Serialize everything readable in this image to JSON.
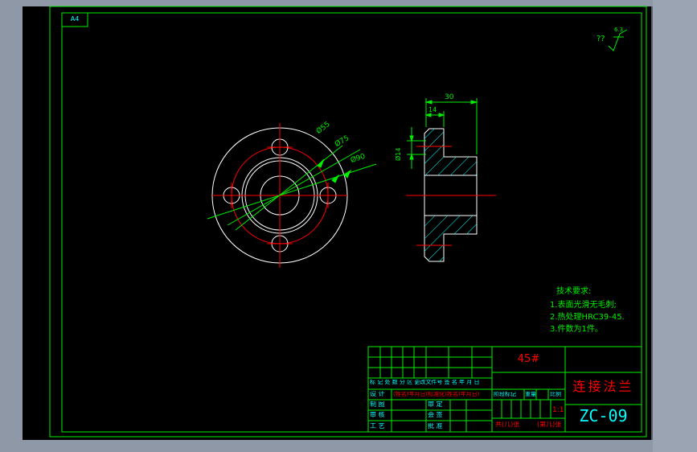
{
  "colors": {
    "background_gray": "#8e98a7",
    "line_green": "#00ee00",
    "line_red": "#ff0000",
    "line_white": "#ffffff",
    "hatch_cyan": "#00ffff",
    "text_cyan": "#00ffff"
  },
  "frame": {
    "sheet_label": "A4"
  },
  "roughness_note": {
    "prefix": "??",
    "value": "6.3"
  },
  "front_view": {
    "dim_labels": [
      "Ø55",
      "Ø75",
      "Ø90"
    ]
  },
  "section_view": {
    "dim_width": "30",
    "dim_hub": "14",
    "dim_bore": "Ø14"
  },
  "tech_requirements": {
    "title": "技术要求:",
    "items": [
      "1.表面光滑无毛刺;",
      "2.热处理HRC39-45.",
      "3.件数为1件。"
    ]
  },
  "title_block": {
    "material": "45#",
    "part_name": "连接法兰",
    "drawing_no": "ZC-09",
    "scale_value": "1:1",
    "header_row": "标 记 处 数 分 区 更改文件号 签 名 年 月 日",
    "design_label": "设 计",
    "design_signature": "(姓名)年月日(标准化(姓名)年月日)",
    "stage_label": "阶段标记",
    "weight_label": "重量",
    "scale_label": "比例",
    "rows": [
      {
        "left": "制 图",
        "mid": "审 定"
      },
      {
        "left": "审 核",
        "mid": "会 签"
      },
      {
        "left": "工 艺",
        "mid": "批 准"
      }
    ],
    "sheets_total": "共(几)张",
    "sheet_no": "(第几)张"
  }
}
